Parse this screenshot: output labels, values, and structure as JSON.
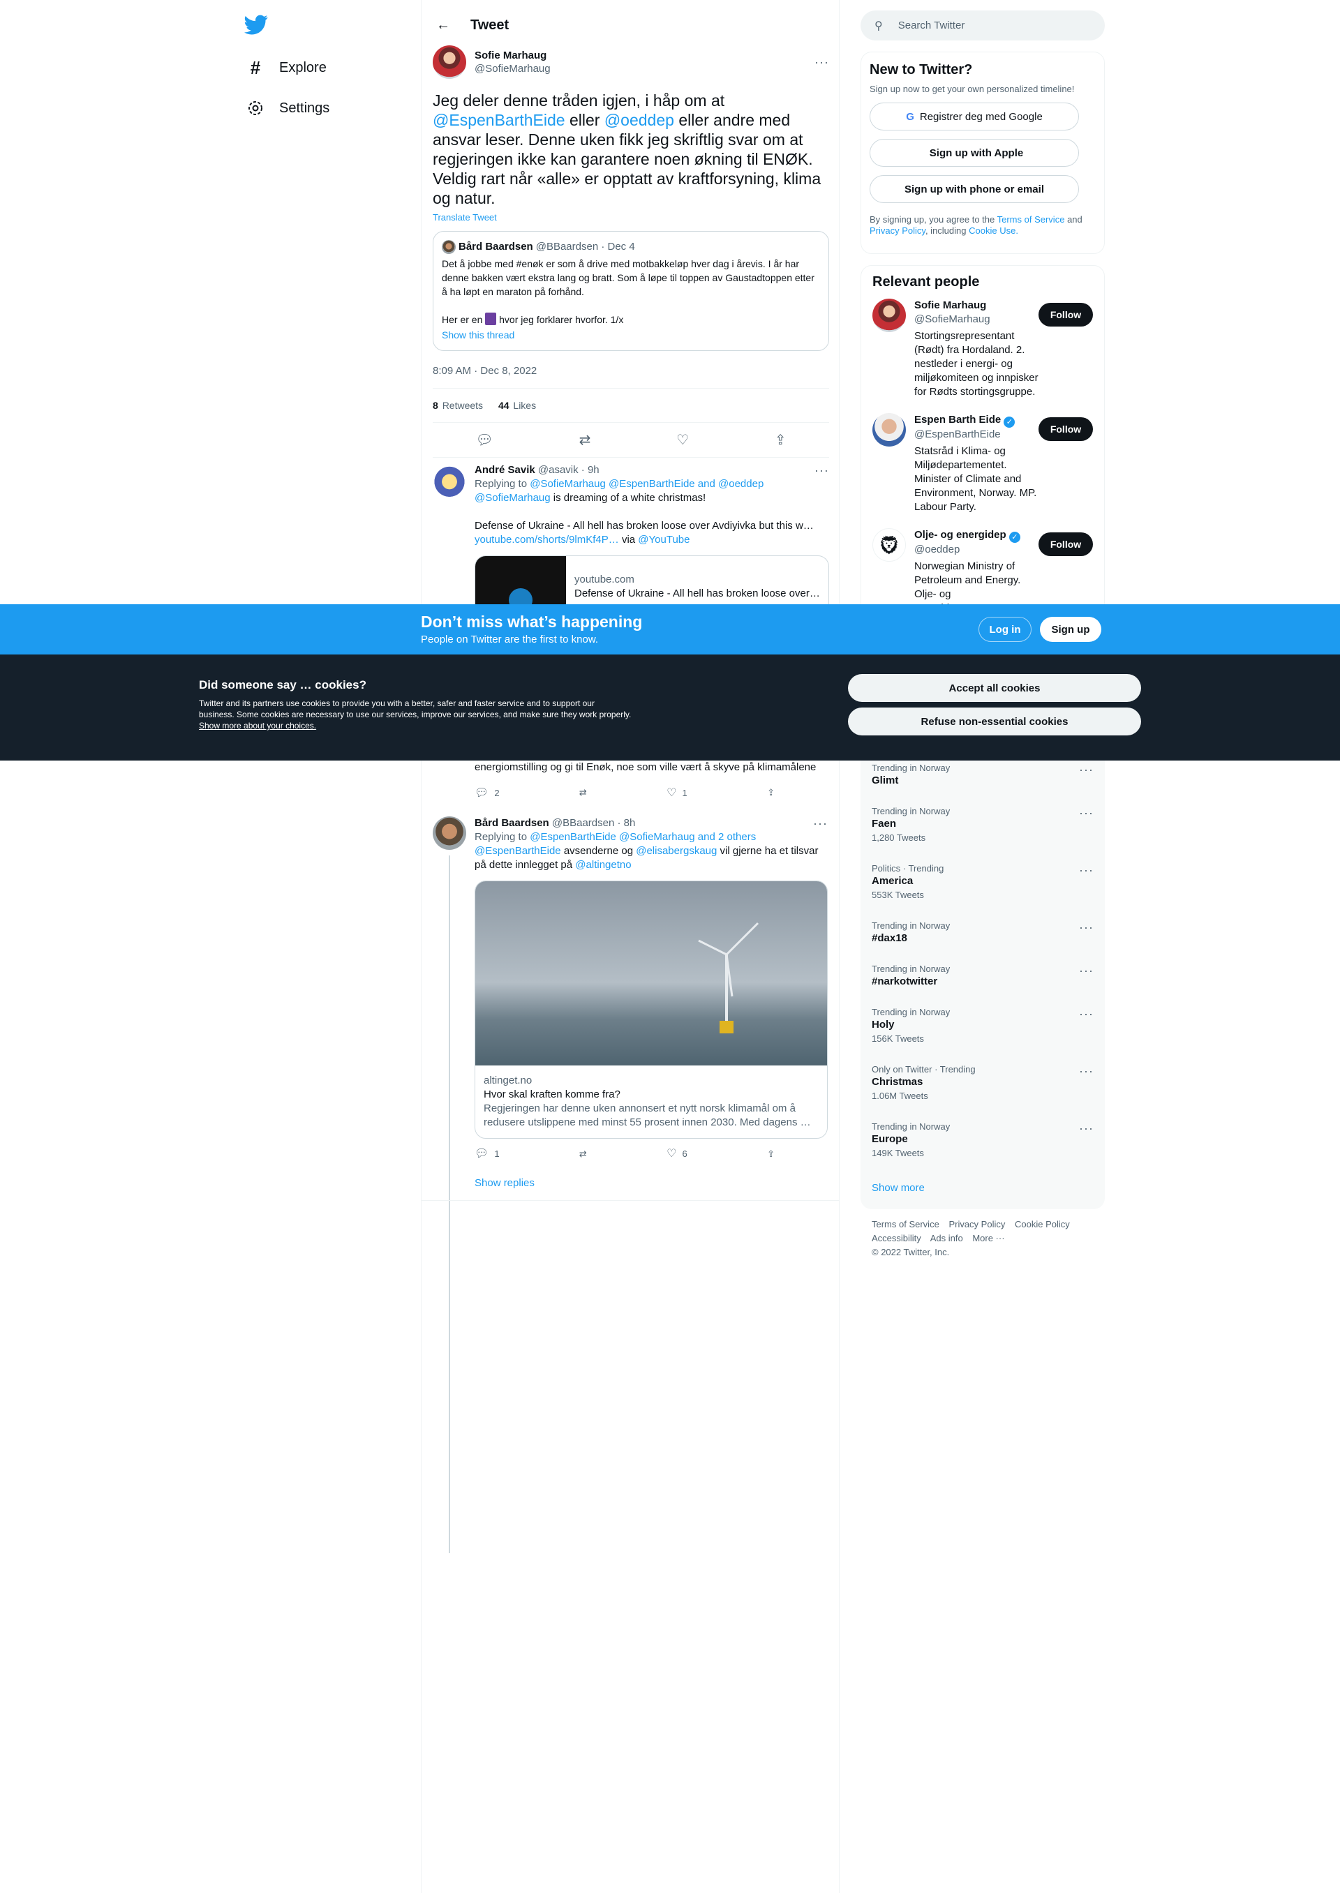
{
  "nav": {
    "logo": "twitter-bird",
    "items": [
      {
        "label": "Explore",
        "icon": "hashtag-icon"
      },
      {
        "label": "Settings",
        "icon": "gear-icon"
      }
    ]
  },
  "header": {
    "title": "Tweet"
  },
  "tweet": {
    "name": "Sofie Marhaug",
    "handle": "@SofieMarhaug",
    "text_1": "Jeg deler denne tråden igjen, i håp om at",
    "mention_1": "@EspenBarthEide",
    "text_2": "eller",
    "mention_2": "@oeddep",
    "text_3": "eller andre med ansvar leser. Denne uken fikk jeg skriftlig svar om at regjeringen ikke kan garantere noen økning til ENØK. Veldig rart når «alle» er opptatt av kraftforsyning, klima og natur.",
    "translate": "Translate Tweet",
    "quote": {
      "name": "Bård Baardsen",
      "handle_date": "@BBaardsen · Dec 4",
      "text": "Det å jobbe med #enøk er som å drive med motbakkeløp hver dag i årevis. I år har denne bakken vært ekstra lang og bratt. Som å løpe til toppen av Gaustadtoppen etter å ha løpt en maraton på forhånd.",
      "text_2_a": "Her er en",
      "text_2_b": "hvor jeg forklarer hvorfor. 1/x",
      "show_thread": "Show this thread"
    },
    "time": "8:09 AM · Dec 8, 2022",
    "retweets_count": "8",
    "retweets_label": "Retweets",
    "likes_count": "44",
    "likes_label": "Likes"
  },
  "replies": [
    {
      "name": "André Savik",
      "handle_time": "@asavik · 9h",
      "replying_prefix": "Replying to",
      "replying_to": "@SofieMarhaug @EspenBarthEide and @oeddep",
      "mention": "@SofieMarhaug",
      "text": "is dreaming of a white christmas!",
      "text_2": "Defense of Ukraine - All hell has broken loose over Avdiyivka but this w…",
      "link": "youtube.com/shorts/9lmKf4P…",
      "via": "via",
      "via_handle": "@YouTube",
      "card_domain": "youtube.com",
      "card_title": "Defense of Ukraine - All hell has broken loose over…"
    },
    {
      "text_partial": "energiomstilling og gi til Enøk, noe som ville vært å skyve på klimamålene",
      "reply_count": "2",
      "like_count": "1"
    },
    {
      "name": "Bård Baardsen",
      "handle_time": "@BBaardsen · 8h",
      "replying_prefix": "Replying to",
      "replying_to": "@EspenBarthEide @SofieMarhaug and 2 others",
      "mention_1": "@EspenBarthEide",
      "text_1": "avsenderne og",
      "mention_2": "@elisabergskaug",
      "text_2": "vil gjerne ha et tilsvar på dette innlegget på",
      "mention_3": "@altingetno",
      "card_domain": "altinget.no",
      "card_title": "Hvor skal kraften komme fra?",
      "card_desc": "Regjeringen har denne uken annonsert et nytt norsk klimamål om å redusere utslippene med minst 55 prosent innen 2030. Med dagens …",
      "reply_count": "1",
      "like_count": "6",
      "show_replies": "Show replies"
    }
  ],
  "search": {
    "placeholder": "Search Twitter"
  },
  "new_to": {
    "title": "New to Twitter?",
    "sub": "Sign up now to get your own personalized timeline!",
    "google": "Registrer deg med Google",
    "apple": "Sign up with Apple",
    "phone": "Sign up with phone or email",
    "tos_1": "By signing up, you agree to the",
    "tos_link_1": "Terms of Service",
    "tos_2": "and",
    "tos_link_2": "Privacy Policy",
    "tos_3": ", including",
    "tos_link_3": "Cookie Use."
  },
  "relevant": {
    "title": "Relevant people",
    "follow": "Follow",
    "people": [
      {
        "name": "Sofie Marhaug",
        "handle": "@SofieMarhaug",
        "bio": "Stortingsrepresentant (Rødt) fra Hordaland. 2. nestleder i energi- og miljøkomiteen og innpisker for Rødts stortingsgruppe."
      },
      {
        "name": "Espen Barth Eide",
        "handle": "@EspenBarthEide",
        "bio": "Statsråd i Klima- og Miljødepartementet. Minister of Climate and Environment, Norway. MP. Labour Party."
      },
      {
        "name": "Olje- og energidep",
        "handle": "@oeddep",
        "bio": "Norwegian Ministry of Petroleum and Energy. Olje- og energidepartementets hovedoppgave er å tilrettelegge en samordnet og helhetlig energipolitikk."
      }
    ]
  },
  "trends": {
    "items": [
      {
        "ctx": "Trending in Norway",
        "title": "Glimt",
        "count": ""
      },
      {
        "ctx": "Trending in Norway",
        "title": "Faen",
        "count": "1,280 Tweets"
      },
      {
        "ctx": "Politics · Trending",
        "title": "America",
        "count": "553K Tweets"
      },
      {
        "ctx": "Trending in Norway",
        "title": "#dax18",
        "count": ""
      },
      {
        "ctx": "Trending in Norway",
        "title": "#narkotwitter",
        "count": ""
      },
      {
        "ctx": "Trending in Norway",
        "title": "Holy",
        "count": "156K Tweets"
      },
      {
        "ctx": "Only on Twitter · Trending",
        "title": "Christmas",
        "count": "1.06M Tweets"
      },
      {
        "ctx": "Trending in Norway",
        "title": "Europe",
        "count": "149K Tweets"
      }
    ],
    "show_more": "Show more"
  },
  "footer": {
    "links_1": [
      "Terms of Service",
      "Privacy Policy",
      "Cookie Policy"
    ],
    "links_2": [
      "Accessibility",
      "Ads info",
      "More ···"
    ],
    "copyright": "© 2022 Twitter, Inc."
  },
  "banner": {
    "title": "Don’t miss what’s happening",
    "sub": "People on Twitter are the first to know.",
    "login": "Log in",
    "signup": "Sign up"
  },
  "cookie": {
    "title": "Did someone say … cookies?",
    "body": "Twitter and its partners use cookies to provide you with a better, safer and faster service and to support our business. Some cookies are necessary to use our services, improve our services, and make sure they work properly.",
    "link": "Show more about your choices.",
    "accept": "Accept all cookies",
    "refuse": "Refuse non-essential cookies"
  },
  "colors": {
    "accent": "#1d9bf0",
    "text": "#0f1419",
    "muted": "#536471",
    "cookie_bg": "#15202b"
  }
}
